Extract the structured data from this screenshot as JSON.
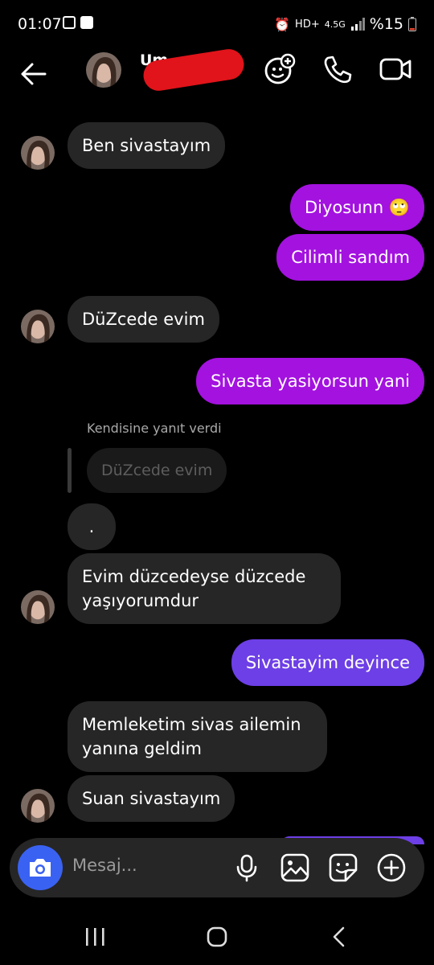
{
  "status_bar": {
    "time": "01:07",
    "network": "4.5G",
    "battery": "%15"
  },
  "header": {
    "name": "Um",
    "status": "",
    "icons": [
      "back-arrow-icon",
      "effects-icon",
      "phone-icon",
      "video-icon"
    ]
  },
  "messages": [
    {
      "id": 1,
      "side": "in",
      "text": "Ben sivastayım"
    },
    {
      "id": 2,
      "side": "out",
      "text": "Diyosunn 🙄"
    },
    {
      "id": 3,
      "side": "out",
      "text": "Cilimli sandım"
    },
    {
      "id": 4,
      "side": "in",
      "text": "DüZcede evim"
    },
    {
      "id": 5,
      "side": "out",
      "text": "Sivasta yasiyorsun yani"
    },
    {
      "id": 6,
      "side": "in",
      "text": "."
    },
    {
      "id": 7,
      "side": "in",
      "text": "Evim düzcedeyse düzcede yaşıyorumdur"
    },
    {
      "id": 8,
      "side": "out",
      "text": "Sivastayim deyince"
    },
    {
      "id": 9,
      "side": "in",
      "text": "Memleketim sivas ailemin yanına geldim"
    },
    {
      "id": 10,
      "side": "in",
      "text": "Suan sivastayım"
    }
  ],
  "reply": {
    "label": "Kendisine yanıt verdi",
    "quote": "DüZcede evim"
  },
  "composer": {
    "placeholder": "Mesaj..."
  },
  "colors": {
    "background": "#000000",
    "incoming_bubble": "#262626",
    "outgoing_purple": "#a312df",
    "outgoing_violet": "#6d3fe6",
    "camera_button": "#3a62f2"
  }
}
